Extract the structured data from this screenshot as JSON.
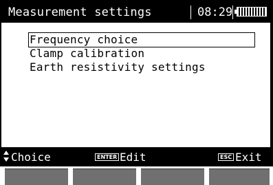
{
  "header": {
    "title": "Measurement settings",
    "time": "08:29",
    "battery_icon": "battery-full-icon"
  },
  "menu": {
    "items": [
      {
        "label": "Frequency choice",
        "selected": true
      },
      {
        "label": "Clamp calibration",
        "selected": false
      },
      {
        "label": "Earth resistivity settings",
        "selected": false
      }
    ]
  },
  "footer": {
    "choice_label": "Choice",
    "enter_key": "ENTER",
    "edit_label": "Edit",
    "esc_key": "ESC",
    "exit_label": "Exit"
  },
  "colors": {
    "bar_background": "#000000",
    "panel_background": "#ffffff",
    "function_key": "#707070"
  }
}
